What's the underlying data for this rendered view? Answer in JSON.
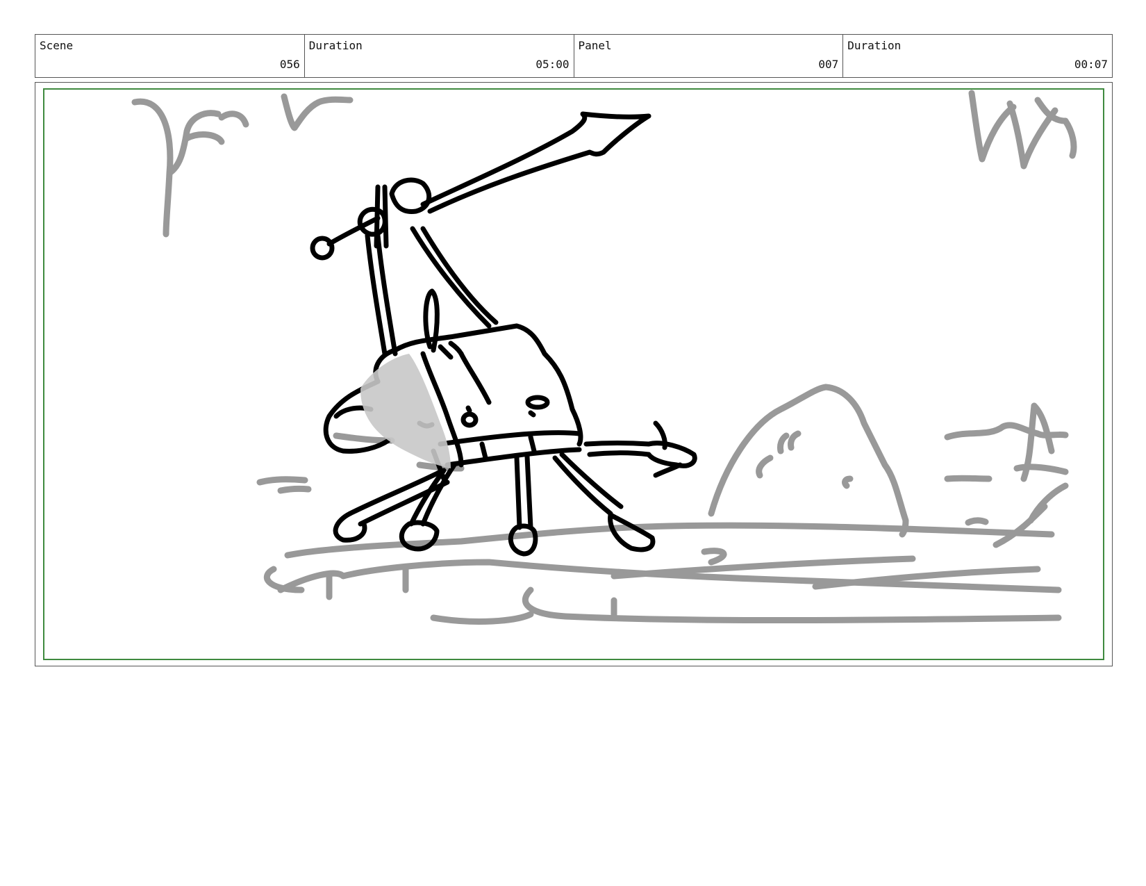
{
  "header": {
    "cells": [
      {
        "label": "Scene",
        "value": "056"
      },
      {
        "label": "Duration",
        "value": "05:00"
      },
      {
        "label": "Panel",
        "value": "007"
      },
      {
        "label": "Duration",
        "value": "00:07"
      }
    ]
  },
  "panel": {
    "colors": {
      "frame": "#555555",
      "safe_area": "#3f8a3f",
      "ink": "#000000",
      "background_ink": "#999999",
      "shade": "#c8c8c8"
    }
  }
}
